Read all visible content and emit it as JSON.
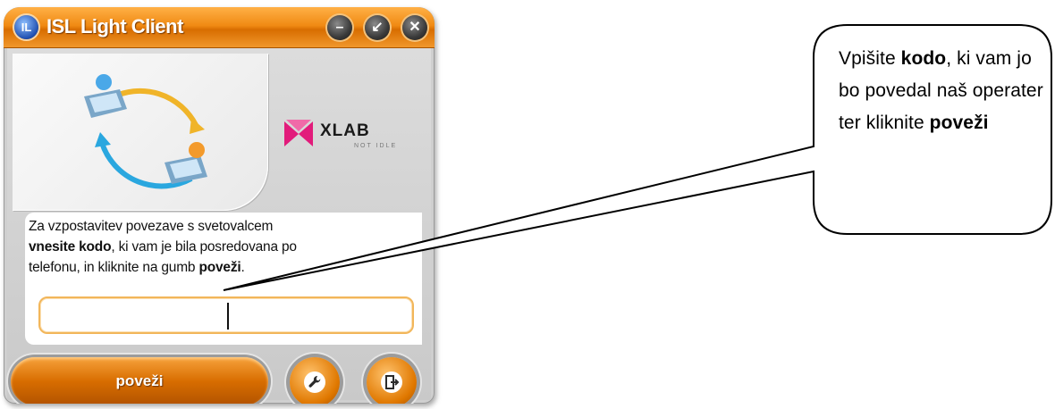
{
  "window": {
    "title": "ISL Light Client",
    "app_icon_label": "IL",
    "buttons": {
      "minimize": "–",
      "restore": "↙",
      "close": "✕"
    }
  },
  "brand": {
    "name": "XLAB",
    "tagline": "NOT IDLE"
  },
  "instructions": {
    "line1": "Za vzpostavitev povezave s svetovalcem",
    "bold1": "vnesite kodo",
    "line2_rest": ", ki vam je bila posredovana po",
    "line3_pre": "telefonu, in kliknite na gumb ",
    "bold2": "poveži",
    "line3_post": "."
  },
  "code_input": {
    "value": "",
    "placeholder": ""
  },
  "connect_button": {
    "label": "poveži"
  },
  "icons": [
    "app-logo-icon",
    "minimize-icon",
    "restore-icon",
    "close-icon",
    "wrench-icon",
    "exit-icon",
    "xlab-logo-icon"
  ],
  "callout": {
    "t1": "Vpišite ",
    "b1": "kodo",
    "t2": ", ki vam jo bo povedal naš operater ter kliknite ",
    "b2": "poveži"
  },
  "colors": {
    "accent": "#f08a13",
    "input_border": "#f2b65a",
    "panel": "#cfcfcf"
  }
}
